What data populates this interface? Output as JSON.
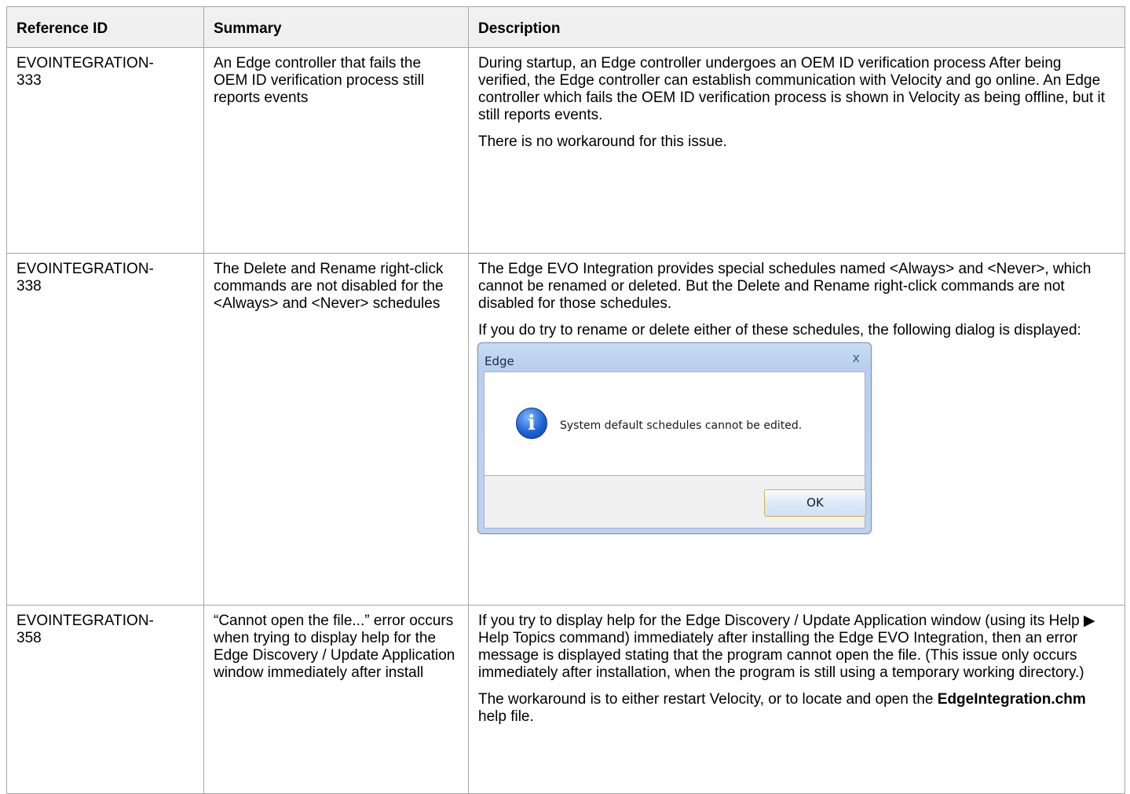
{
  "headers": [
    "Reference ID",
    "Summary",
    "Description"
  ],
  "rows": [
    {
      "ref": "EVOINTEGRATION-\n333",
      "summary": "An Edge controller that fails the OEM ID verification process still reports events",
      "desc": [
        "During startup, an Edge controller undergoes an OEM ID verification process  After being verified, the Edge controller can establish communication with Velocity and go online.  An Edge controller which fails the OEM ID verification process is shown in Velocity as being offline, but it still reports events.",
        "There is no workaround for this issue."
      ]
    },
    {
      "ref": "EVOINTEGRATION-\n338",
      "summary": "The Delete and Rename right-click commands are not disabled for the <Always> and <Never> schedules",
      "desc": [
        "The Edge EVO Integration provides special schedules named <Always> and <Never>, which cannot be renamed or deleted.  But the Delete and Rename right-click commands are not disabled for those schedules.",
        "If you do try to rename or delete either of these schedules, the following dialog is displayed:"
      ],
      "dialog": {
        "title": "Edge",
        "close": "x",
        "icon": "info-icon",
        "message": "System default schedules cannot be edited.",
        "ok": "OK"
      }
    },
    {
      "ref": "EVOINTEGRATION-\n358",
      "summary": "“Cannot open the file...” error occurs when trying to display help for the Edge Discovery / Update Application window immediately after install",
      "desc": [
        "If you try to display help for the Edge Discovery / Update Application window (using its Help ▶ Help Topics command) immediately after installing the Edge EVO Integration, then an error message is displayed stating that the program cannot open the file.  (This issue only occurs immediately after installation, when the program is still using a temporary working directory.)"
      ],
      "desc_last": {
        "before": "The workaround is to either restart Velocity, or to locate and open the ",
        "bold": "EdgeIntegration.chm",
        "after": " help file."
      }
    }
  ]
}
